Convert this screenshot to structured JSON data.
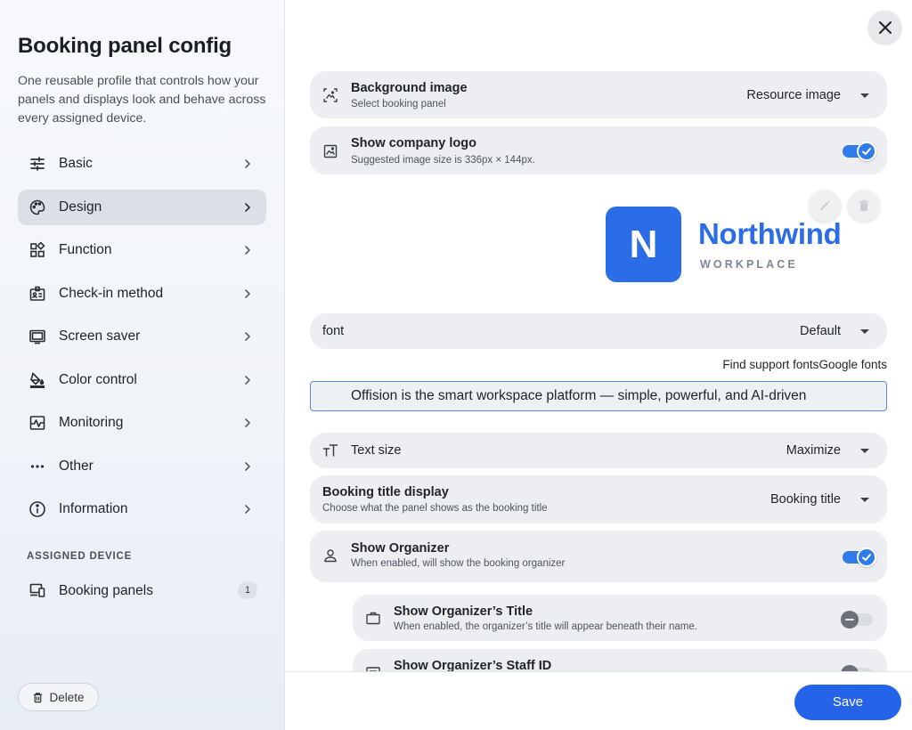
{
  "sidebar": {
    "title": "Booking panel config",
    "description": "One reusable profile that controls how your panels and displays look and behave across every assigned device.",
    "items": [
      {
        "label": "Basic",
        "icon": "sliders-icon"
      },
      {
        "label": "Design",
        "icon": "palette-icon",
        "active": true
      },
      {
        "label": "Function",
        "icon": "widgets-icon"
      },
      {
        "label": "Check-in method",
        "icon": "id-badge-icon"
      },
      {
        "label": "Screen saver",
        "icon": "screen-icon"
      },
      {
        "label": "Color control",
        "icon": "paint-bucket-icon"
      },
      {
        "label": "Monitoring",
        "icon": "monitoring-icon"
      },
      {
        "label": "Other",
        "icon": "more-horiz-icon"
      },
      {
        "label": "Information",
        "icon": "info-icon"
      }
    ],
    "assigned_section": "ASSIGNED DEVICE",
    "device": {
      "label": "Booking panels",
      "count": "1"
    },
    "delete_label": "Delete"
  },
  "settings": {
    "background_image": {
      "title": "Background image",
      "subtitle": "Select booking panel",
      "value": "Resource image"
    },
    "company_logo": {
      "title": "Show company logo",
      "subtitle": "Suggested image size is 336px × 144px.",
      "enabled": true
    },
    "logo": {
      "mark": "N",
      "name": "Northwind",
      "tagline": "WORKPLACE"
    },
    "font": {
      "title": "font",
      "value": "Default"
    },
    "font_links": {
      "support": "Find support fonts",
      "google": "Google fonts"
    },
    "preview_text": "Offision is the smart workspace platform — simple, powerful, and AI-driven",
    "text_size": {
      "title": "Text size",
      "value": "Maximize"
    },
    "booking_title": {
      "title": "Booking title display",
      "subtitle": "Choose what the panel shows as the booking title",
      "value": "Booking title"
    },
    "show_organizer": {
      "title": "Show Organizer",
      "subtitle": "When enabled, will show the booking organizer",
      "enabled": true
    },
    "organizer_title": {
      "title": "Show Organizer’s Title",
      "subtitle": "When enabled, the organizer’s title will appear beneath their name.",
      "enabled": false
    },
    "organizer_staff_id": {
      "title": "Show Organizer’s Staff ID",
      "enabled": false
    }
  },
  "footer": {
    "save_label": "Save"
  },
  "colors": {
    "accent": "#2563e8",
    "toggle_on": "#2f7be8",
    "row_bg": "#eceef1",
    "logo_blue": "#2b6de6"
  }
}
